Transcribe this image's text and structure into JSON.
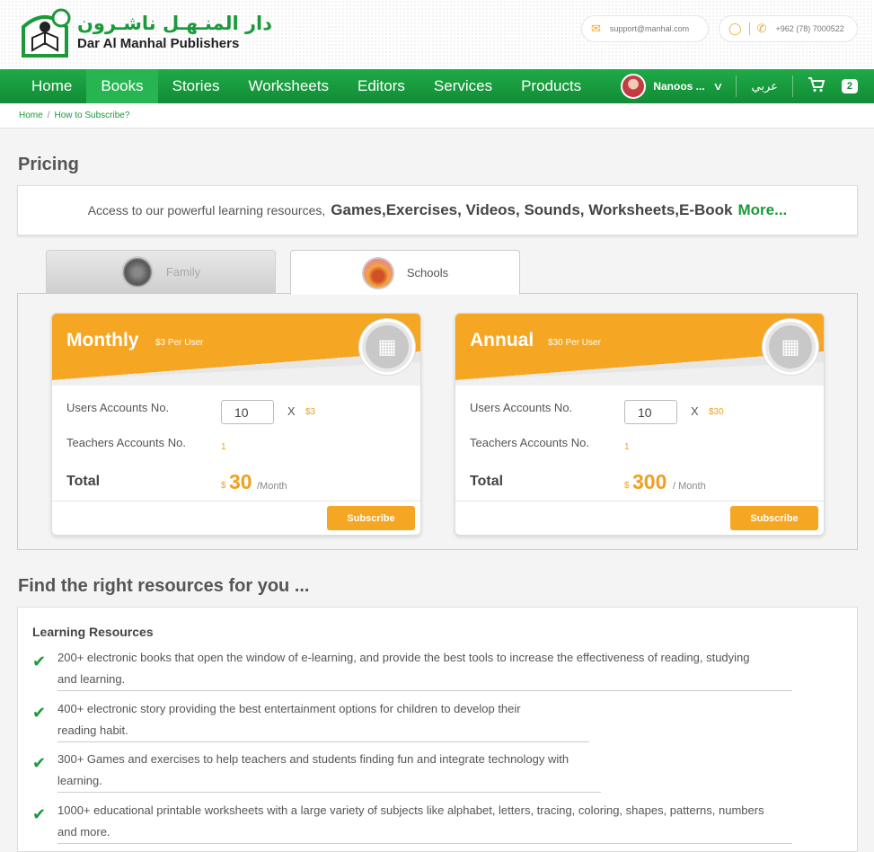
{
  "header": {
    "logo_ar": "دار المنـهـل ناشـرون",
    "logo_en": "Dar Al Manhal Publishers",
    "email": "support@manhal.com",
    "phone": "+962 (78) 7000522",
    "icons": {
      "email": "envelope-icon",
      "whatsapp": "whatsapp-icon",
      "phone": "phone-icon"
    }
  },
  "nav": {
    "items": [
      "Home",
      "Books",
      "Stories",
      "Worksheets",
      "Editors",
      "Services",
      "Products"
    ],
    "active_index": 1,
    "user_name": "Nanoos ...",
    "lang": "عربي",
    "cart_count": "2"
  },
  "breadcrumb": {
    "home": "Home",
    "sep": "/",
    "current": "How to Subscribe?"
  },
  "pricing": {
    "title": "Pricing",
    "access_intro": "Access to our powerful learning resources,",
    "access_list": "Games,Exercises, Videos, Sounds, Worksheets,E-Book",
    "access_more": "More...",
    "tabs": [
      "Family",
      "Schools"
    ],
    "active_tab": 1,
    "plans": [
      {
        "name": "Monthly",
        "rate": "$3 Per User",
        "users_label": "Users Accounts No.",
        "users_value": "10",
        "times": "X",
        "unit_price": "$3",
        "teachers_label": "Teachers Accounts No.",
        "teachers_value": "1",
        "total_label": "Total",
        "currency": "$",
        "total": "30",
        "per": "/Month",
        "button": "Subscribe"
      },
      {
        "name": "Annual",
        "rate": "$30 Per User",
        "users_label": "Users Accounts No.",
        "users_value": "10",
        "times": "X",
        "unit_price": "$30",
        "teachers_label": "Teachers Accounts No.",
        "teachers_value": "1",
        "total_label": "Total",
        "currency": "$",
        "total": "300",
        "per": "/ Month",
        "button": "Subscribe"
      }
    ]
  },
  "resources": {
    "title": "Find the right resources for you ...",
    "heading": "Learning Resources",
    "items": [
      {
        "line1": "200+ electronic books that open the window of e-learning, and provide the best tools to increase the effectiveness of reading, studying",
        "line2": "and learning."
      },
      {
        "line1": "400+ electronic story providing the best entertainment options for children to develop their",
        "line2": "reading habit."
      },
      {
        "line1": "300+ Games and exercises to help teachers and students finding fun and integrate technology with",
        "line2": "learning."
      },
      {
        "line1": "1000+ educational printable worksheets with a large variety of subjects like alphabet, letters, tracing, coloring, shapes, patterns, numbers",
        "line2": "and more."
      }
    ]
  },
  "colors": {
    "green": "#1a9a3a",
    "orange": "#f5a623"
  }
}
